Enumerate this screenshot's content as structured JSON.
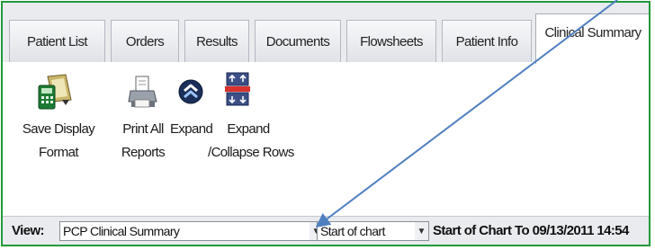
{
  "tabs": [
    {
      "label": "Patient List",
      "active": false
    },
    {
      "label": "Orders",
      "active": false
    },
    {
      "label": "Results",
      "active": false
    },
    {
      "label": "Documents",
      "active": false
    },
    {
      "label": "Flowsheets",
      "active": false
    },
    {
      "label": "Patient Info",
      "active": false
    },
    {
      "label": "Clinical Summary",
      "active": true
    }
  ],
  "toolbar": {
    "save_display_format": {
      "line1": "Save Display",
      "line2": "Format",
      "icon": "calculator-save-icon"
    },
    "print_all_reports": {
      "line1": "Print All",
      "line2": "Reports",
      "icon": "printer-icon"
    },
    "expand": {
      "line1": "Expand",
      "icon": "chevron-up-circle-icon"
    },
    "expand_collapse_rows": {
      "line1": "Expand",
      "line2": "/Collapse Rows",
      "icon": "expand-collapse-rows-icon"
    }
  },
  "viewbar": {
    "view_label": "View:",
    "view_select": "PCP Clinical Summary",
    "range_select": "Start of chart",
    "range_text": "Start of Chart To 09/13/2011 14:54"
  },
  "colors": {
    "frame_border": "#1f9a3a",
    "annotation_arrow": "#4f7fbf"
  }
}
